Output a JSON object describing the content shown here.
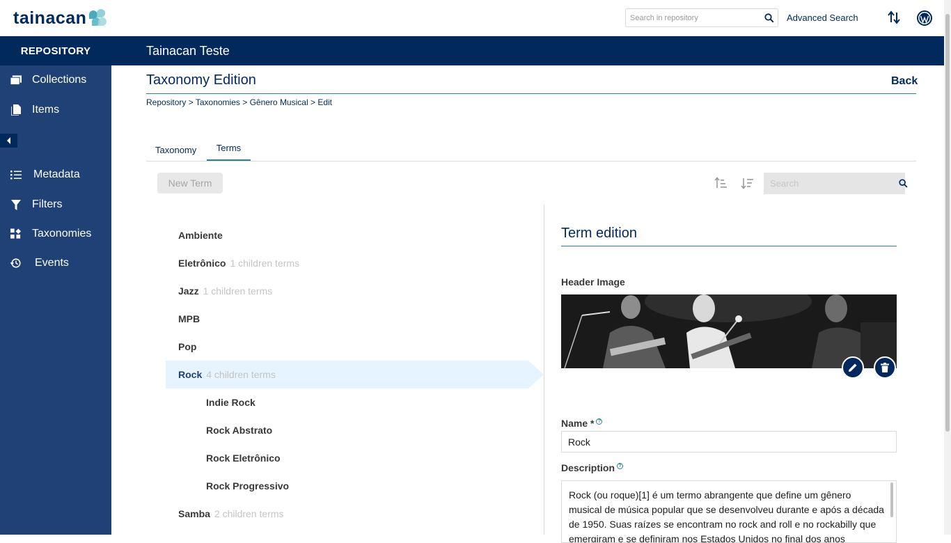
{
  "header": {
    "logo_text": "tainacan",
    "search_placeholder": "Search in repository",
    "advanced_search": "Advanced Search"
  },
  "band": {
    "repository_label": "REPOSITORY",
    "site_title": "Tainacan Teste"
  },
  "sidebar": {
    "items": [
      {
        "label": "Collections",
        "icon": "collections-icon"
      },
      {
        "label": "Items",
        "icon": "items-icon"
      },
      {
        "label": "Metadata",
        "icon": "metadata-icon"
      },
      {
        "label": "Filters",
        "icon": "filter-icon"
      },
      {
        "label": "Taxonomies",
        "icon": "taxonomies-icon"
      },
      {
        "label": "Events",
        "icon": "events-icon"
      }
    ]
  },
  "page": {
    "title": "Taxonomy Edition",
    "back": "Back",
    "breadcrumb": {
      "repository": "Repository",
      "taxonomies": "Taxonomies",
      "genre": "Gênero Musical",
      "edit": "Edit",
      "sep": ">"
    },
    "tabs": [
      {
        "label": "Taxonomy",
        "active": false
      },
      {
        "label": "Terms",
        "active": true
      }
    ],
    "new_term": "New Term",
    "term_search_placeholder": "Search"
  },
  "terms": [
    {
      "name": "Ambiente",
      "children": ""
    },
    {
      "name": "Eletrônico",
      "children": "1 children terms"
    },
    {
      "name": "Jazz",
      "children": "1 children terms"
    },
    {
      "name": "MPB",
      "children": ""
    },
    {
      "name": "Pop",
      "children": ""
    },
    {
      "name": "Rock",
      "children": "4 children terms",
      "selected": true
    },
    {
      "name": "Indie Rock",
      "children": "",
      "child": true
    },
    {
      "name": "Rock Abstrato",
      "children": "",
      "child": true
    },
    {
      "name": "Rock Eletrônico",
      "children": "",
      "child": true
    },
    {
      "name": "Rock Progressivo",
      "children": "",
      "child": true
    },
    {
      "name": "Samba",
      "children": "2 children terms"
    }
  ],
  "term_edition": {
    "title": "Term edition",
    "header_image_label": "Header Image",
    "name_label": "Name *",
    "name_value": "Rock",
    "description_label": "Description",
    "description_value": "Rock (ou roque)[1] é um termo abrangente que define um gênero musical de música popular que se desenvolveu durante e após a década de 1950. Suas raízes se encontram no rock and roll e no rockabilly que emergiram e se definiram nos Estados Unidos no final dos anos quarenta e início dos"
  },
  "colors": {
    "brand_dark": "#01295c",
    "sidebar": "#1f4175",
    "accent": "#298596",
    "selected_row": "#e6f4ff"
  }
}
